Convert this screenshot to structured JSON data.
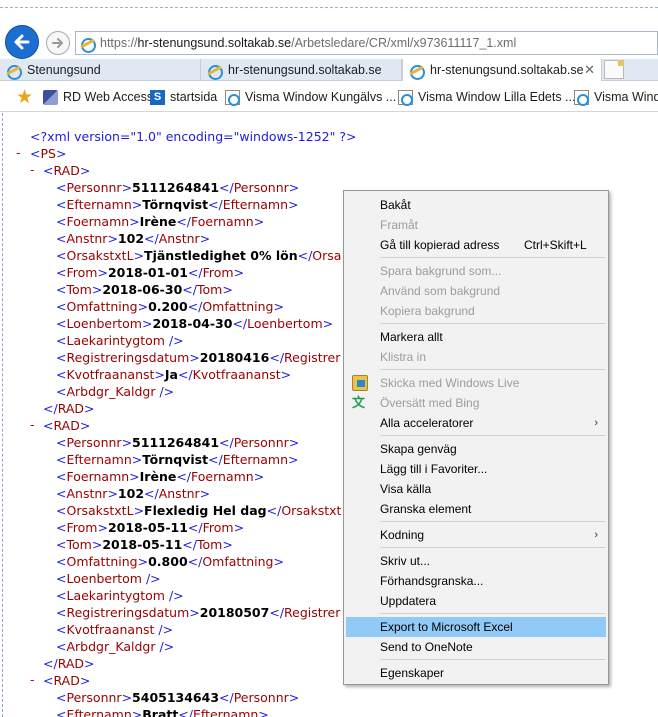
{
  "browser": {
    "url_scheme": "https://",
    "url_host": "hr-stenungsund.soltakab.se",
    "url_path": "/Arbetsledare/CR/xml/x973611117_1.xml",
    "tabs": [
      {
        "label": "Stenungsund"
      },
      {
        "label": "hr-stenungsund.soltakab.se"
      },
      {
        "label": "hr-stenungsund.soltakab.se"
      }
    ],
    "tab_close": "✕",
    "favorites": [
      {
        "label": "RD Web Access"
      },
      {
        "label": "startsida"
      },
      {
        "label": "Visma Window Kungälvs ..."
      },
      {
        "label": "Visma Window Lilla Edets ..."
      },
      {
        "label": "Visma Window"
      }
    ]
  },
  "xml": {
    "declaration": "<?xml version=\"1.0\" encoding=\"windows-1252\" ?>",
    "lines": [
      {
        "indent": 0,
        "minus": "-",
        "open": "<PS>",
        "value": "",
        "close": ""
      },
      {
        "indent": 1,
        "minus": "-",
        "open": "<RAD>",
        "value": "",
        "close": ""
      },
      {
        "indent": 2,
        "minus": "",
        "open": "<Personnr>",
        "value": "5111264841",
        "close": "</Personnr>"
      },
      {
        "indent": 2,
        "minus": "",
        "open": "<Efternamn>",
        "value": "Törnqvist",
        "close": "</Efternamn>"
      },
      {
        "indent": 2,
        "minus": "",
        "open": "<Foernamn>",
        "value": "Irène",
        "close": "</Foernamn>"
      },
      {
        "indent": 2,
        "minus": "",
        "open": "<Anstnr>",
        "value": "102",
        "close": "</Anstnr>"
      },
      {
        "indent": 2,
        "minus": "",
        "open": "<OrsakstxtL>",
        "value": "Tjänstledighet 0% lön",
        "close": "</Orsa"
      },
      {
        "indent": 2,
        "minus": "",
        "open": "<From>",
        "value": "2018-01-01",
        "close": "</From>"
      },
      {
        "indent": 2,
        "minus": "",
        "open": "<Tom>",
        "value": "2018-06-30",
        "close": "</Tom>"
      },
      {
        "indent": 2,
        "minus": "",
        "open": "<Omfattning>",
        "value": "0.200",
        "close": "</Omfattning>"
      },
      {
        "indent": 2,
        "minus": "",
        "open": "<Loenbertom>",
        "value": "2018-04-30",
        "close": "</Loenbertom>"
      },
      {
        "indent": 2,
        "minus": "",
        "open": "<Laekarintygtom />",
        "value": "",
        "close": ""
      },
      {
        "indent": 2,
        "minus": "",
        "open": "<Registreringsdatum>",
        "value": "20180416",
        "close": "</Registrer"
      },
      {
        "indent": 2,
        "minus": "",
        "open": "<Kvotfraananst>",
        "value": "Ja",
        "close": "</Kvotfraananst>"
      },
      {
        "indent": 2,
        "minus": "",
        "open": "<Arbdgr_Kaldgr />",
        "value": "",
        "close": ""
      },
      {
        "indent": 1,
        "minus": "",
        "open": "</RAD>",
        "value": "",
        "close": ""
      },
      {
        "indent": 1,
        "minus": "-",
        "open": "<RAD>",
        "value": "",
        "close": ""
      },
      {
        "indent": 2,
        "minus": "",
        "open": "<Personnr>",
        "value": "5111264841",
        "close": "</Personnr>"
      },
      {
        "indent": 2,
        "minus": "",
        "open": "<Efternamn>",
        "value": "Törnqvist",
        "close": "</Efternamn>"
      },
      {
        "indent": 2,
        "minus": "",
        "open": "<Foernamn>",
        "value": "Irène",
        "close": "</Foernamn>"
      },
      {
        "indent": 2,
        "minus": "",
        "open": "<Anstnr>",
        "value": "102",
        "close": "</Anstnr>"
      },
      {
        "indent": 2,
        "minus": "",
        "open": "<OrsakstxtL>",
        "value": "Flexledig Hel dag",
        "close": "</Orsakstxt"
      },
      {
        "indent": 2,
        "minus": "",
        "open": "<From>",
        "value": "2018-05-11",
        "close": "</From>"
      },
      {
        "indent": 2,
        "minus": "",
        "open": "<Tom>",
        "value": "2018-05-11",
        "close": "</Tom>"
      },
      {
        "indent": 2,
        "minus": "",
        "open": "<Omfattning>",
        "value": "0.800",
        "close": "</Omfattning>"
      },
      {
        "indent": 2,
        "minus": "",
        "open": "<Loenbertom />",
        "value": "",
        "close": ""
      },
      {
        "indent": 2,
        "minus": "",
        "open": "<Laekarintygtom />",
        "value": "",
        "close": ""
      },
      {
        "indent": 2,
        "minus": "",
        "open": "<Registreringsdatum>",
        "value": "20180507",
        "close": "</Registrer"
      },
      {
        "indent": 2,
        "minus": "",
        "open": "<Kvotfraananst />",
        "value": "",
        "close": ""
      },
      {
        "indent": 2,
        "minus": "",
        "open": "<Arbdgr_Kaldgr />",
        "value": "",
        "close": ""
      },
      {
        "indent": 1,
        "minus": "",
        "open": "</RAD>",
        "value": "",
        "close": ""
      },
      {
        "indent": 1,
        "minus": "-",
        "open": "<RAD>",
        "value": "",
        "close": ""
      },
      {
        "indent": 2,
        "minus": "",
        "open": "<Personnr>",
        "value": "5405134643",
        "close": "</Personnr>"
      },
      {
        "indent": 2,
        "minus": "",
        "open": "<Efternamn>",
        "value": "Bratt",
        "close": "</Efternamn>"
      }
    ]
  },
  "context_menu": {
    "items": [
      {
        "label": "Bakåt",
        "enabled": true
      },
      {
        "label": "Framåt",
        "enabled": false
      },
      {
        "label": "Gå till kopierad adress",
        "shortcut": "Ctrl+Skift+L",
        "enabled": true
      },
      {
        "sep": true
      },
      {
        "label": "Spara bakgrund som...",
        "enabled": false
      },
      {
        "label": "Använd som bakgrund",
        "enabled": false
      },
      {
        "label": "Kopiera bakgrund",
        "enabled": false
      },
      {
        "sep": true
      },
      {
        "label": "Markera allt",
        "enabled": true
      },
      {
        "label": "Klistra in",
        "enabled": false
      },
      {
        "sep": true
      },
      {
        "label": "Skicka med Windows Live",
        "enabled": false,
        "icon": "windows-live-icon"
      },
      {
        "label": "Översätt med Bing",
        "enabled": false,
        "icon": "bing-translate-icon"
      },
      {
        "label": "Alla acceleratorer",
        "enabled": true,
        "submenu": true
      },
      {
        "sep": true
      },
      {
        "label": "Skapa genväg",
        "enabled": true
      },
      {
        "label": "Lägg till i Favoriter...",
        "enabled": true
      },
      {
        "label": "Visa källa",
        "enabled": true
      },
      {
        "label": "Granska element",
        "enabled": true
      },
      {
        "sep": true
      },
      {
        "label": "Kodning",
        "enabled": true,
        "submenu": true
      },
      {
        "sep": true
      },
      {
        "label": "Skriv ut...",
        "enabled": true
      },
      {
        "label": "Förhandsgranska...",
        "enabled": true
      },
      {
        "label": "Uppdatera",
        "enabled": true
      },
      {
        "sep": true
      },
      {
        "label": "Export to Microsoft Excel",
        "enabled": true,
        "highlighted": true
      },
      {
        "label": "Send to OneNote",
        "enabled": true
      },
      {
        "sep": true
      },
      {
        "label": "Egenskaper",
        "enabled": true
      }
    ],
    "submenu_arrow": "›"
  },
  "colors": {
    "tag": "#990000",
    "punct": "#1c1ce0",
    "highlight": "#91c9f7",
    "back_button": "#1c6fd1"
  }
}
